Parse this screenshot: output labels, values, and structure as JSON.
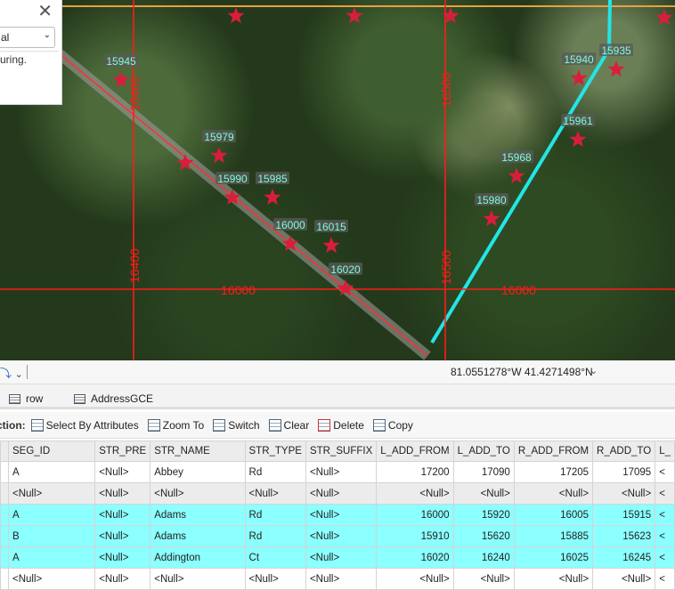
{
  "map": {
    "grid_labels": {
      "v1": "16400",
      "v2": "16500",
      "h": "16000"
    },
    "address_points": [
      "15945",
      "15979",
      "15990",
      "15985",
      "16000",
      "16015",
      "16020",
      "15968",
      "15980",
      "15961",
      "15940",
      "15935"
    ],
    "colors": {
      "grid": "#ff1a1a",
      "star": "#d81e3a",
      "selected_line": "#22e5e5",
      "label_text": "#7fffd9",
      "label_bg": "#5a5a5a"
    }
  },
  "panel": {
    "close": "✕",
    "dropdown_value": "al",
    "text": "uring."
  },
  "status": {
    "coordinates": "81.0551278°W 41.4271498°N"
  },
  "tabs": [
    {
      "label": "row"
    },
    {
      "label": "AddressGCE"
    }
  ],
  "toolbar": {
    "label": "ction:",
    "buttons": [
      "Select By Attributes",
      "Zoom To",
      "Switch",
      "Clear",
      "Delete",
      "Copy"
    ]
  },
  "table": {
    "columns": [
      "SEG_ID",
      "STR_PRE",
      "STR_NAME",
      "STR_TYPE",
      "STR_SUFFIX",
      "L_ADD_FROM",
      "L_ADD_TO",
      "R_ADD_FROM",
      "R_ADD_TO",
      "L_"
    ],
    "rows": [
      {
        "state": "w",
        "cells": [
          "A",
          "<Null>",
          "Abbey",
          "Rd",
          "<Null>",
          "17200",
          "17090",
          "17205",
          "17095",
          "<"
        ]
      },
      {
        "state": "nul",
        "cells": [
          "<Null>",
          "<Null>",
          "<Null>",
          "<Null>",
          "<Null>",
          "<Null>",
          "<Null>",
          "<Null>",
          "<Null>",
          "<"
        ]
      },
      {
        "state": "sel",
        "cells": [
          "A",
          "<Null>",
          "Adams",
          "Rd",
          "<Null>",
          "16000",
          "15920",
          "16005",
          "15915",
          "<"
        ]
      },
      {
        "state": "sel",
        "cells": [
          "B",
          "<Null>",
          "Adams",
          "Rd",
          "<Null>",
          "15910",
          "15620",
          "15885",
          "15623",
          "<"
        ]
      },
      {
        "state": "sel",
        "cells": [
          "A",
          "<Null>",
          "Addington",
          "Ct",
          "<Null>",
          "16020",
          "16240",
          "16025",
          "16245",
          "<"
        ]
      },
      {
        "state": "w",
        "cells": [
          "<Null>",
          "<Null>",
          "<Null>",
          "<Null>",
          "<Null>",
          "<Null>",
          "<Null>",
          "<Null>",
          "<Null>",
          "<"
        ]
      }
    ]
  }
}
